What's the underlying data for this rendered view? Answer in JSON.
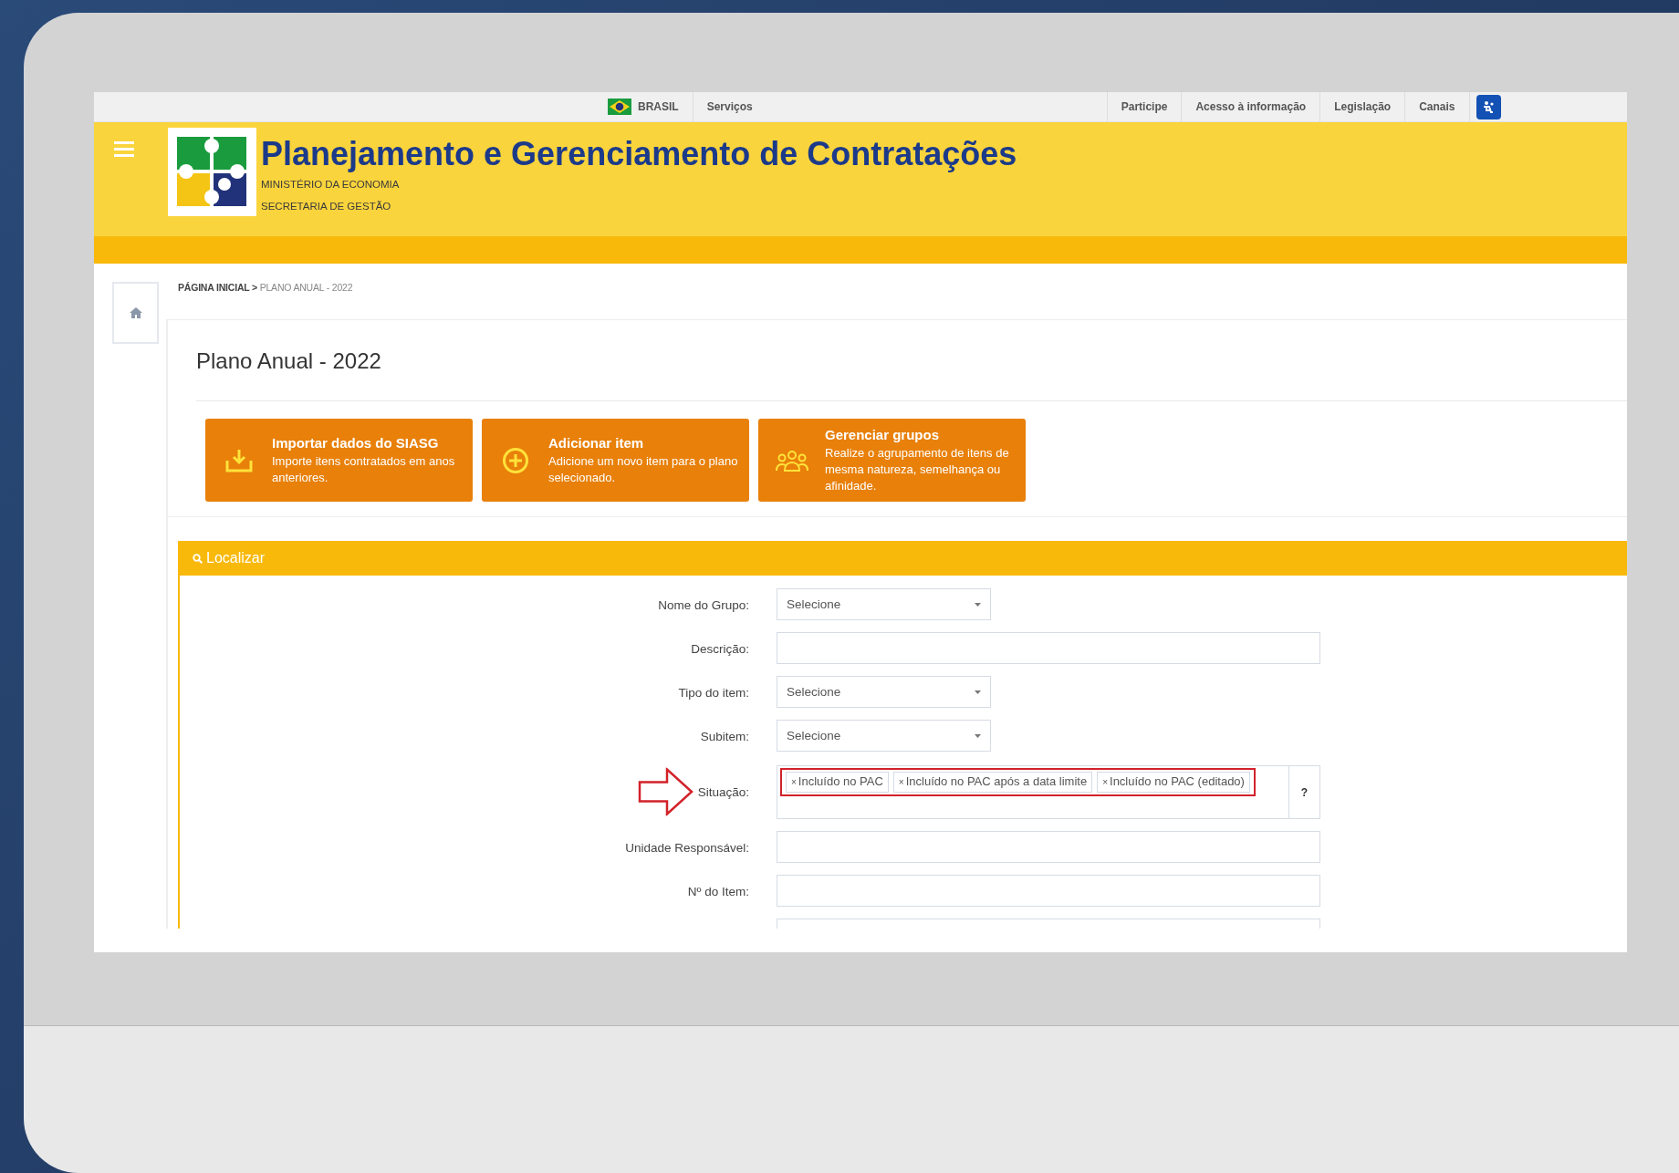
{
  "gov_bar": {
    "country": "BRASIL",
    "services": "Serviços",
    "links": [
      "Participe",
      "Acesso à informação",
      "Legislação",
      "Canais"
    ]
  },
  "header": {
    "title": "Planejamento e Gerenciamento de Contratações",
    "subtitles": [
      "MINISTÉRIO DA ECONOMIA",
      "SECRETARIA DE GESTÃO"
    ]
  },
  "breadcrumb": {
    "separator": ">",
    "items": [
      {
        "label": "PÁGINA INICIAL",
        "current": false
      },
      {
        "label": "PLANO ANUAL - 2022",
        "current": true
      }
    ]
  },
  "page_title": "Plano Anual - 2022",
  "actions": [
    {
      "kind": "import",
      "title": "Importar dados do SIASG",
      "description": "Importe itens contratados em anos anteriores."
    },
    {
      "kind": "add",
      "title": "Adicionar item",
      "description": "Adicione um novo item para o plano selecionado."
    },
    {
      "kind": "groups",
      "title": "Gerenciar grupos",
      "description": "Realize o agrupamento de itens de mesma natureza, semelhança ou afinidade."
    }
  ],
  "search": {
    "title": "Localizar",
    "fields": [
      {
        "kind": "select",
        "label": "Nome do Grupo:",
        "value": "Selecione"
      },
      {
        "kind": "text",
        "label": "Descrição:"
      },
      {
        "kind": "select",
        "label": "Tipo do item:",
        "value": "Selecione"
      },
      {
        "kind": "select",
        "label": "Subitem:",
        "value": "Selecione"
      },
      {
        "kind": "tags",
        "label": "Situação:",
        "highlighted": true,
        "help": "?",
        "tags": [
          {
            "remove": "×",
            "label": "Incluído no PAC"
          },
          {
            "remove": "×",
            "label": "Incluído no PAC após a data limite"
          },
          {
            "remove": "×",
            "label": "Incluído no PAC (editado)"
          }
        ]
      },
      {
        "kind": "text",
        "label": "Unidade Responsável:"
      },
      {
        "kind": "text",
        "label": "Nº do Item:"
      },
      {
        "kind": "text"
      }
    ]
  }
}
